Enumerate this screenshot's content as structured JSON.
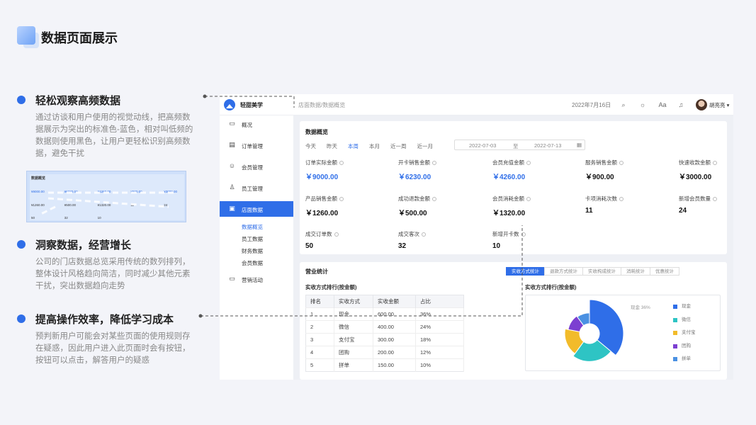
{
  "page": {
    "title": "数据页面展示"
  },
  "features": [
    {
      "title": "轻松观察高频数据",
      "desc": "通过访谈和用户使用的视觉动线，把高频数据展示为突出的标准色-蓝色，相对叫低频的数据则使用黑色，让用户更轻松识别高频数据，避免干扰"
    },
    {
      "title": "洞察数据，经营增长",
      "desc": "公司的门店数据总览采用传统的数列排列，整体设计风格趋向简洁，同时减少其他元素干扰，突出数据趋向走势"
    },
    {
      "title": "提高操作效率，降低学习成本",
      "desc": "预判新用户可能会对某些页面的使用规则存在疑惑，因此用户进入此页面时会有按钮，按钮可以点击，解答用户的疑惑"
    }
  ],
  "thumb": {
    "title": "数据概览",
    "row1": [
      "¥9000.00",
      "¥6230.00",
      "¥4260.00",
      "¥900.00",
      "¥3000.00"
    ],
    "row2": [
      "¥1260.00",
      "¥500.00",
      "¥1320.00",
      "11",
      "24"
    ],
    "row3": [
      "50",
      "32",
      "10"
    ]
  },
  "app": {
    "brand": "轻甜美学",
    "breadcrumb": "店面数据/数据概览",
    "date": "2022年7月16日",
    "user": "胡亮亮 ▾",
    "icons": {
      "search": "⌕",
      "theme": "☼",
      "font": "Aa",
      "bell": "♫"
    },
    "sidebar": [
      {
        "label": "概况",
        "icon": "▭"
      },
      {
        "label": "订单管理",
        "icon": "▤"
      },
      {
        "label": "会员管理",
        "icon": "☺"
      },
      {
        "label": "员工管理",
        "icon": "♙"
      },
      {
        "label": "店面数据",
        "icon": "▣"
      },
      {
        "label": "营销活动",
        "icon": "▭"
      }
    ],
    "subnav": [
      "数据概览",
      "员工数据",
      "财务数据",
      "会员数据"
    ],
    "overview": {
      "title": "数据概览",
      "tabs": [
        "今天",
        "昨天",
        "本周",
        "本月",
        "近一周",
        "近一月"
      ],
      "active_tab": "本周",
      "date_from": "2022-07-03",
      "date_sep": "至",
      "date_to": "2022-07-13",
      "calendar_icon": "▦",
      "kpis": [
        {
          "label": "订单实际金额",
          "value": "￥9000.00",
          "blue": true
        },
        {
          "label": "开卡销售金额",
          "value": "￥6230.00",
          "blue": true
        },
        {
          "label": "会员充值金额",
          "value": "￥4260.00",
          "blue": true
        },
        {
          "label": "服务销售金额",
          "value": "￥900.00",
          "blue": false
        },
        {
          "label": "快速收款金额",
          "value": "￥3000.00",
          "blue": false
        },
        {
          "label": "产品销售金额",
          "value": "￥1260.00",
          "blue": false
        },
        {
          "label": "成功退款金额",
          "value": "￥500.00",
          "blue": false
        },
        {
          "label": "会员消耗金额",
          "value": "￥1320.00",
          "blue": false
        },
        {
          "label": "卡项消耗次数",
          "value": "11",
          "blue": false
        },
        {
          "label": "新增会员数量",
          "value": "24",
          "blue": false
        },
        {
          "label": "成交订单数",
          "value": "50",
          "blue": false
        },
        {
          "label": "成交客次",
          "value": "32",
          "blue": false
        },
        {
          "label": "新增开卡数",
          "value": "10",
          "blue": false
        }
      ]
    },
    "business": {
      "title": "营业统计",
      "tabs": [
        "实收方式统计",
        "退款方式统计",
        "实收构成统计",
        "消耗统计",
        "优惠统计"
      ],
      "table_title": "实收方式排行(按金额)",
      "pie_title": "实收方式排行(按金额)",
      "columns": [
        "排名",
        "实收方式",
        "实收金额",
        "占比"
      ],
      "rows": [
        [
          "1",
          "现金",
          "600.00",
          "36%"
        ],
        [
          "2",
          "微信",
          "400.00",
          "24%"
        ],
        [
          "3",
          "支付宝",
          "300.00",
          "18%"
        ],
        [
          "4",
          "团购",
          "200.00",
          "12%"
        ],
        [
          "5",
          "拼单",
          "150.00",
          "10%"
        ]
      ],
      "pie_label": "现金  36%"
    }
  },
  "chart_data": {
    "type": "pie",
    "title": "实收方式排行(按金额)",
    "categories": [
      "现金",
      "微信",
      "支付宝",
      "团购",
      "拼单"
    ],
    "values": [
      36,
      24,
      18,
      12,
      10
    ],
    "colors": [
      "#2f6ee8",
      "#2ec4c4",
      "#f2bb2a",
      "#7c3fd1",
      "#4a90e2"
    ],
    "legend": "right"
  }
}
